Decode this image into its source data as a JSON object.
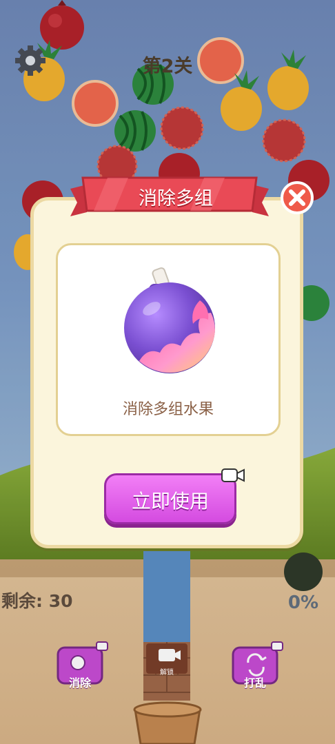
{
  "level": {
    "title": "第2关"
  },
  "hud": {
    "remaining": "剩余: 30",
    "progress_percent": "0%"
  },
  "tools": {
    "eliminate_label": "消除",
    "unlock_label": "解锁",
    "shuffle_label": "打乱"
  },
  "modal": {
    "title": "消除多组",
    "description": "消除多组水果",
    "use_button": "立即使用",
    "item_icon": "bomb-icon"
  },
  "colors": {
    "modal_bg": "#fbf5dc",
    "banner": "#e94a56",
    "button": "#e466ee",
    "close": "#ef5a4a"
  }
}
